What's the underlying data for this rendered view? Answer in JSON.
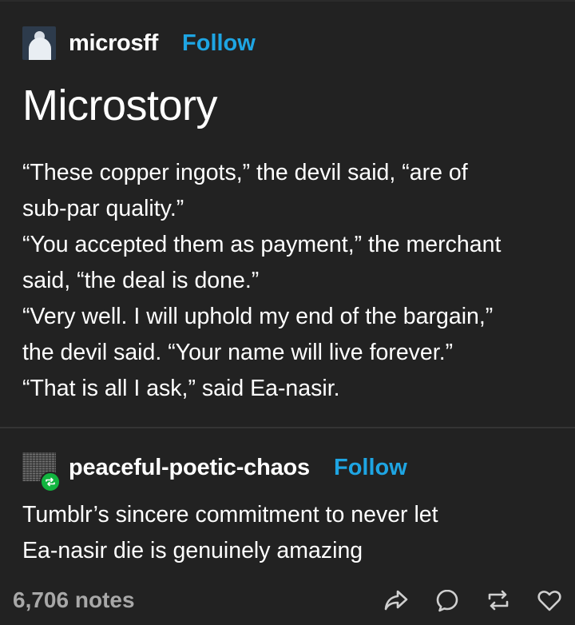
{
  "post": {
    "blog_name": "microsff",
    "follow_label": "Follow",
    "title": "Microstory",
    "body_lines": [
      "“These copper ingots,” the devil said, “are of",
      "sub-par quality.”",
      "“You accepted them as payment,” the merchant",
      "said, “the deal is done.”",
      "“Very well. I will uphold my end of the bargain,”",
      "the devil said. “Your name will live forever.”",
      "“That is all I ask,” said Ea-nasir."
    ]
  },
  "reblog": {
    "blog_name": "peaceful-poetic-chaos",
    "follow_label": "Follow",
    "body_lines": [
      "Tumblr’s sincere commitment to never let",
      "Ea-nasir die is genuinely amazing"
    ]
  },
  "footer": {
    "notes": "6,706 notes",
    "icons": [
      "share-icon",
      "reply-icon",
      "reblog-icon",
      "like-icon"
    ]
  },
  "colors": {
    "background": "#222222",
    "text": "#ffffff",
    "accent_blue": "#1ea5e3",
    "reblog_green": "#11b53f",
    "notes_gray": "#a8a8a8"
  }
}
